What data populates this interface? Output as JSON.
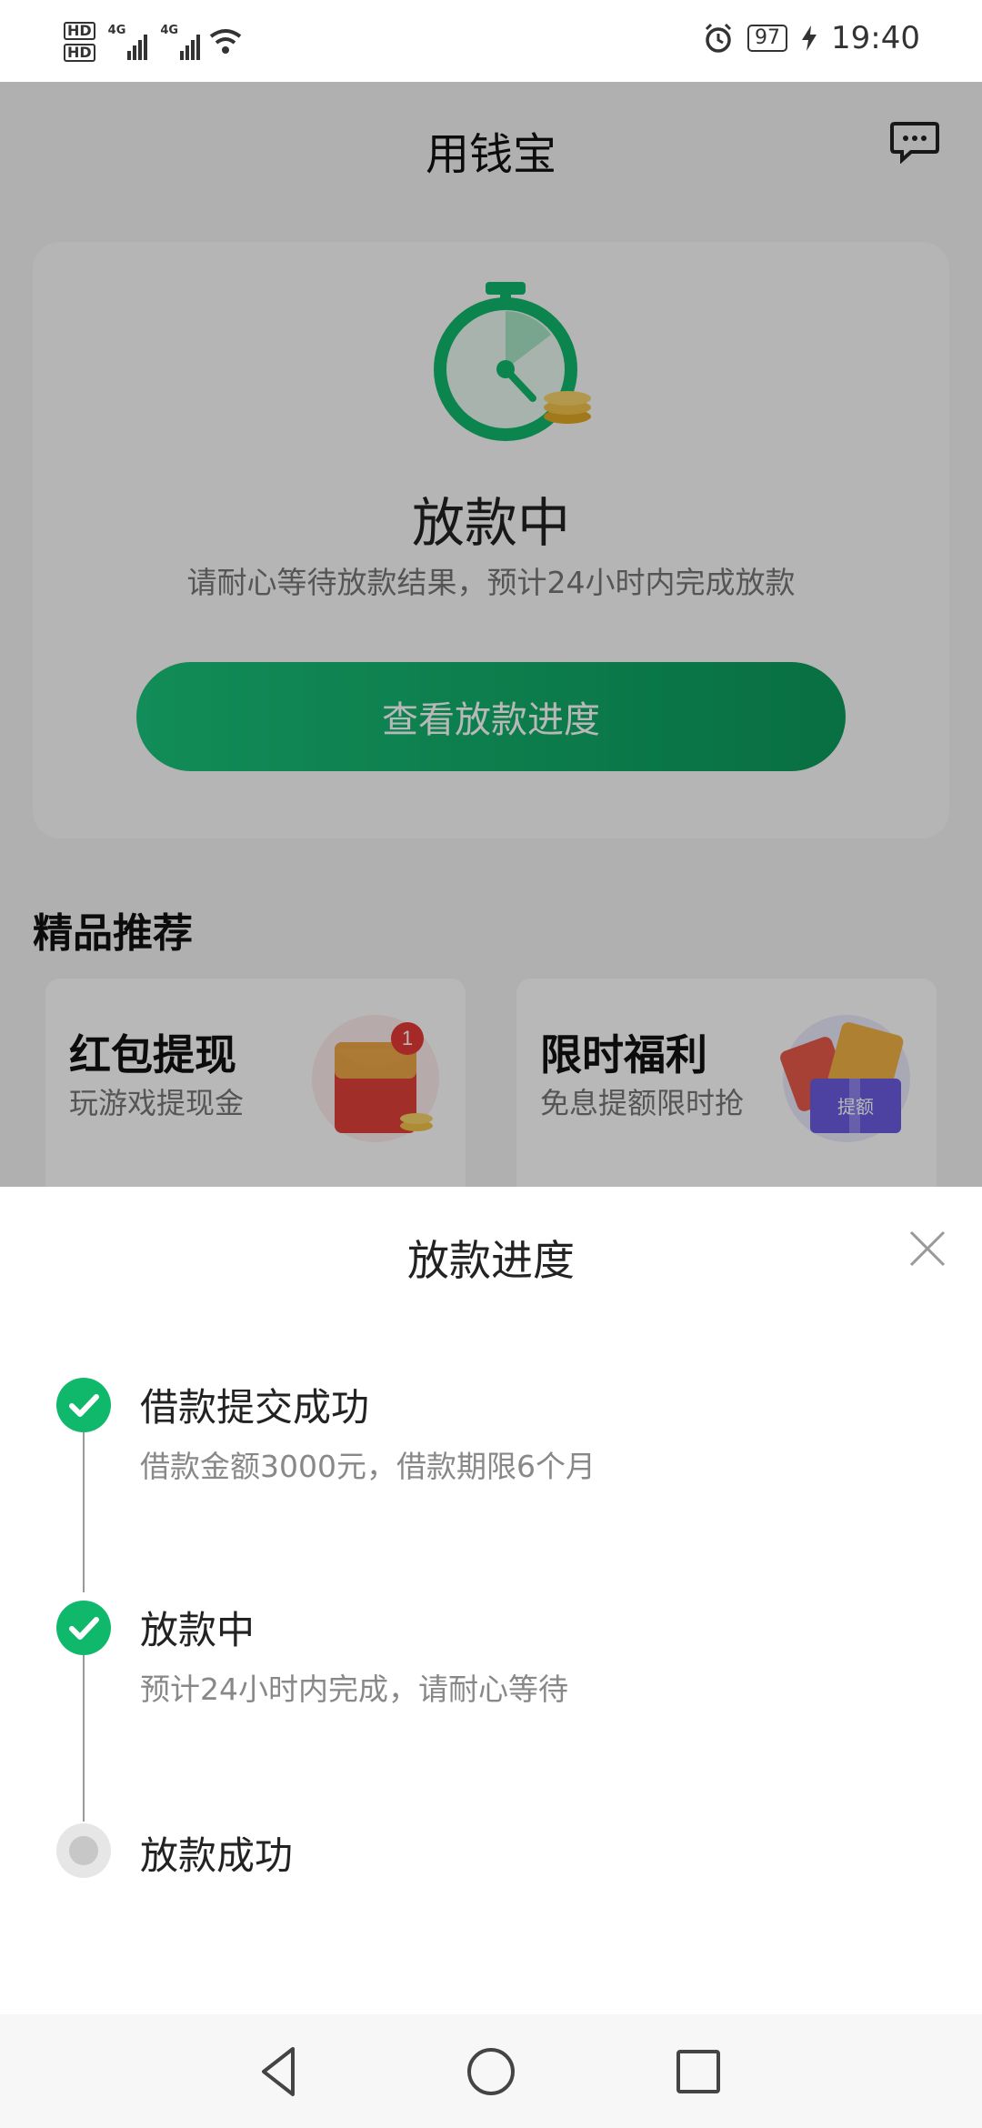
{
  "status_bar": {
    "sim1": "HD",
    "sim2": "HD",
    "network1": "4G",
    "network2": "4G",
    "battery": "97",
    "time": "19:40",
    "icons": [
      "alarm-icon",
      "wifi-icon",
      "charging-icon"
    ]
  },
  "app": {
    "title": "用钱宝",
    "status_title": "放款中",
    "status_desc": "请耐心等待放款结果，预计24小时内完成放款",
    "progress_button": "查看放款进度",
    "section_title": "精品推荐",
    "promos": [
      {
        "title": "红包提现",
        "subtitle": "玩游戏提现金",
        "badge": "1"
      },
      {
        "title": "限时福利",
        "subtitle": "免息提额限时抢",
        "tag": "提额"
      }
    ]
  },
  "sheet": {
    "title": "放款进度",
    "steps": [
      {
        "title": "借款提交成功",
        "desc": "借款金额3000元，借款期限6个月",
        "status": "done"
      },
      {
        "title": "放款中",
        "desc": "预计24小时内完成，请耐心等待",
        "status": "done"
      },
      {
        "title": "放款成功",
        "status": "pending"
      }
    ]
  },
  "colors": {
    "accent": "#10b86b",
    "button_gradient_start": "#19c37a",
    "button_gradient_end": "#0c9a5c"
  }
}
